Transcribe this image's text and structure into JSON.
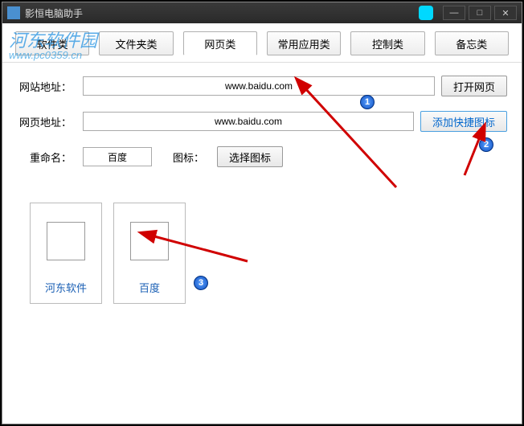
{
  "titlebar": {
    "title": "影恒电脑助手"
  },
  "watermark": {
    "main": "河东软件园",
    "sub": "www.pc0359.cn"
  },
  "tabs": [
    "软件类",
    "文件夹类",
    "网页类",
    "常用应用类",
    "控制类",
    "备忘类"
  ],
  "form": {
    "website_label": "网站地址：",
    "website_value": "www.baidu.com",
    "open_btn": "打开网页",
    "webpage_label": "网页地址：",
    "webpage_value": "www.baidu.com",
    "add_shortcut_btn": "添加快捷图标",
    "rename_label": "重命名：",
    "rename_value": "百度",
    "icon_label": "图标：",
    "choose_icon_btn": "选择图标"
  },
  "shortcuts": [
    {
      "label": "河东软件"
    },
    {
      "label": "百度"
    }
  ],
  "badges": [
    "1",
    "2",
    "3"
  ]
}
